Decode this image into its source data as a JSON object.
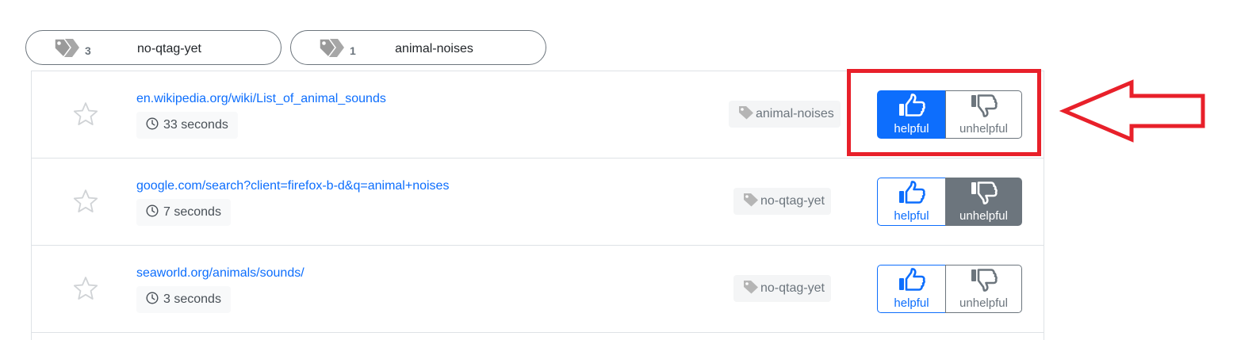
{
  "tag_filters": [
    {
      "count": "3",
      "label": "no-qtag-yet",
      "icon": "tags-icon"
    },
    {
      "count": "1",
      "label": "animal-noises",
      "icon": "tags-icon"
    }
  ],
  "rows": [
    {
      "url": "en.wikipedia.org/wiki/List_of_animal_sounds",
      "duration": "33 seconds",
      "tag": "animal-noises",
      "helpful_label": "helpful",
      "unhelpful_label": "unhelpful",
      "vote": "helpful"
    },
    {
      "url": "google.com/search?client=firefox-b-d&q=animal+noises",
      "duration": "7 seconds",
      "tag": "no-qtag-yet",
      "helpful_label": "helpful",
      "unhelpful_label": "unhelpful",
      "vote": "unhelpful"
    },
    {
      "url": "seaworld.org/animals/sounds/",
      "duration": "3 seconds",
      "tag": "no-qtag-yet",
      "helpful_label": "helpful",
      "unhelpful_label": "unhelpful",
      "vote": "none"
    }
  ],
  "colors": {
    "primary": "#0d6efd",
    "secondary": "#6c757d",
    "annotation": "#e8202a"
  },
  "icons": {
    "star": "star-outline-icon",
    "clock": "clock-icon",
    "tag": "tag-icon",
    "helpful": "thumbs-up-icon",
    "unhelpful": "thumbs-down-icon"
  }
}
